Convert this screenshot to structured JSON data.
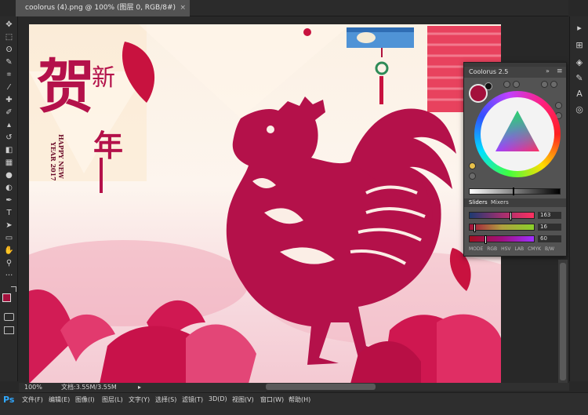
{
  "document": {
    "tab_title": "coolorus (4).png @ 100% (图层 0, RGB/8#)",
    "close_glyph": "×"
  },
  "status": {
    "zoom": "100%",
    "doc_info": "文档:3.55M/3.55M",
    "arrow": "▸"
  },
  "app": {
    "logo": "Ps"
  },
  "menu": [
    {
      "label": "文件(F)"
    },
    {
      "label": "编辑(E)"
    },
    {
      "label": "图像(I)"
    },
    {
      "label": "图层(L)"
    },
    {
      "label": "文字(Y)"
    },
    {
      "label": "选择(S)"
    },
    {
      "label": "滤镜(T)"
    },
    {
      "label": "3D(D)"
    },
    {
      "label": "视图(V)"
    },
    {
      "label": "窗口(W)"
    },
    {
      "label": "帮助(H)"
    }
  ],
  "artwork": {
    "calligraphy_main": "贺",
    "calligraphy_side_1": "新",
    "calligraphy_side_2": "年",
    "english_line_1": "HAPPY NEW",
    "english_line_2": "YEAR 2017"
  },
  "panel": {
    "title": "Coolorus 2.5",
    "expand_glyph": "»",
    "menu_glyph": "≡",
    "tabs": {
      "sliders": "Sliders",
      "mixers": "Mixers"
    },
    "sliders": [
      {
        "value": "163",
        "fraction": 0.64
      },
      {
        "value": "16",
        "fraction": 0.06
      },
      {
        "value": "60",
        "fraction": 0.24
      }
    ],
    "modes": {
      "label": "MODE",
      "rgb": "RGB",
      "hsv": "HSV",
      "lab": "LAB",
      "cmyk": "CMYK",
      "bw": "B/W"
    },
    "foreground_color": "#a3103c",
    "background_color": "#111111",
    "brightness_fraction": 0.48
  },
  "tools": [
    {
      "name": "move-tool-icon",
      "glyph": "✥"
    },
    {
      "name": "marquee-tool-icon",
      "glyph": "⬚"
    },
    {
      "name": "lasso-tool-icon",
      "glyph": "ʘ"
    },
    {
      "name": "quick-select-tool-icon",
      "glyph": "✎"
    },
    {
      "name": "crop-tool-icon",
      "glyph": "⌗"
    },
    {
      "name": "eyedropper-tool-icon",
      "glyph": "⁄"
    },
    {
      "name": "healing-tool-icon",
      "glyph": "✚"
    },
    {
      "name": "brush-tool-icon",
      "glyph": "✐"
    },
    {
      "name": "stamp-tool-icon",
      "glyph": "▴"
    },
    {
      "name": "history-brush-tool-icon",
      "glyph": "↺"
    },
    {
      "name": "eraser-tool-icon",
      "glyph": "◧"
    },
    {
      "name": "gradient-tool-icon",
      "glyph": "▦"
    },
    {
      "name": "blur-tool-icon",
      "glyph": "●"
    },
    {
      "name": "dodge-tool-icon",
      "glyph": "◐"
    },
    {
      "name": "pen-tool-icon",
      "glyph": "✒"
    },
    {
      "name": "type-tool-icon",
      "glyph": "T"
    },
    {
      "name": "path-select-tool-icon",
      "glyph": "➤"
    },
    {
      "name": "shape-tool-icon",
      "glyph": "▭"
    },
    {
      "name": "hand-tool-icon",
      "glyph": "✋"
    },
    {
      "name": "zoom-tool-icon",
      "glyph": "⚲"
    },
    {
      "name": "more-tools-icon",
      "glyph": "···"
    }
  ],
  "right_icons": [
    {
      "name": "collapse-panels-icon",
      "glyph": "▸"
    },
    {
      "name": "history-panel-icon",
      "glyph": "⊞"
    },
    {
      "name": "properties-panel-icon",
      "glyph": "◈"
    },
    {
      "name": "brush-panel-icon",
      "glyph": "✎"
    },
    {
      "name": "character-panel-icon",
      "glyph": "A"
    },
    {
      "name": "coolorus-panel-icon",
      "glyph": "◎"
    }
  ]
}
